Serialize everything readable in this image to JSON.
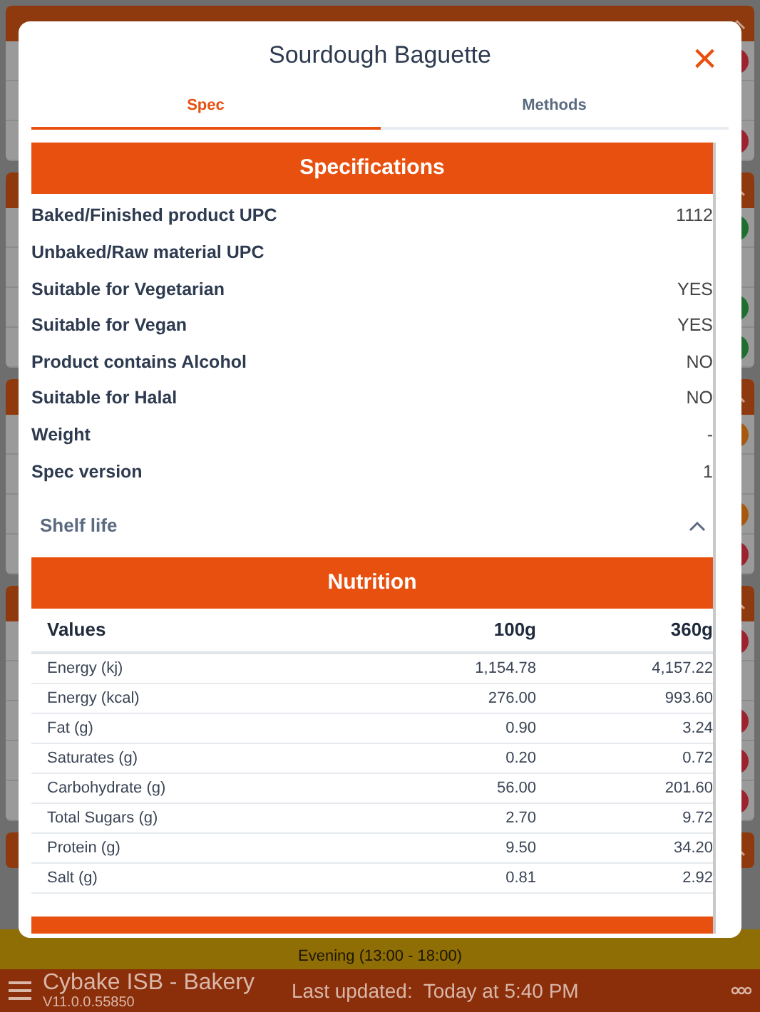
{
  "background": {
    "sections": [
      {
        "expanded": true,
        "rows": [
          {
            "kind": "status",
            "color": "#9b2330"
          },
          {
            "kind": "label"
          },
          {
            "kind": "status",
            "color": "#9b2330"
          }
        ]
      },
      {
        "expanded": true,
        "rows": [
          {
            "kind": "status",
            "color": "#1f6e30"
          },
          {
            "kind": "label"
          },
          {
            "kind": "status",
            "color": "#1f6e30"
          },
          {
            "kind": "status",
            "color": "#1f6e30"
          }
        ]
      },
      {
        "expanded": true,
        "rows": [
          {
            "kind": "status",
            "color": "#a5580f"
          },
          {
            "kind": "label"
          },
          {
            "kind": "status",
            "color": "#a5580f"
          },
          {
            "kind": "status",
            "color": "#9b2330"
          }
        ]
      },
      {
        "expanded": true,
        "rows": [
          {
            "kind": "status",
            "color": "#9b2330"
          },
          {
            "kind": "label"
          },
          {
            "kind": "status",
            "color": "#9b2330"
          },
          {
            "kind": "status",
            "color": "#9b2330"
          },
          {
            "kind": "status",
            "color": "#9b2330"
          }
        ]
      },
      {
        "expanded": true
      }
    ],
    "order_bar": {
      "slot": "Evening (13:00 - 18:00)"
    }
  },
  "modal": {
    "title": "Sourdough Baguette",
    "close": "×",
    "tabs": [
      {
        "label": "Spec",
        "selected": true
      },
      {
        "label": "Methods",
        "selected": false
      }
    ],
    "specifications": {
      "heading": "Specifications",
      "rows": [
        {
          "label": "Baked/Finished product UPC",
          "value": "1112"
        },
        {
          "label": "Unbaked/Raw material UPC"
        },
        {
          "label": "Suitable for Vegetarian",
          "value": "YES"
        },
        {
          "label": "Suitable for Vegan",
          "value": "YES"
        },
        {
          "label": "Product contains Alcohol",
          "value": "NO"
        },
        {
          "label": "Suitable for Halal",
          "value": "NO"
        },
        {
          "label": "Weight",
          "value": "-"
        },
        {
          "label": "Spec version",
          "value": "1"
        }
      ]
    },
    "shelf_life": {
      "label": "Shelf life",
      "expanded": true
    },
    "nutrition": {
      "heading": "Nutrition",
      "columns": [
        "Values",
        "100g",
        "360g"
      ],
      "rows": [
        [
          "Energy (kj)",
          "1,154.78",
          "4,157.22"
        ],
        [
          "Energy (kcal)",
          "276.00",
          "993.60"
        ],
        [
          "Fat (g)",
          "0.90",
          "3.24"
        ],
        [
          "Saturates (g)",
          "0.20",
          "0.72"
        ],
        [
          "Carbohydrate (g)",
          "56.00",
          "201.60"
        ],
        [
          "Total Sugars (g)",
          "2.70",
          "9.72"
        ],
        [
          "Protein (g)",
          "9.50",
          "34.20"
        ],
        [
          "Salt (g)",
          "0.81",
          "2.92"
        ]
      ]
    }
  },
  "footer": {
    "app": "Cybake ISB - Bakery",
    "version": "V11.0.0.55850",
    "last_updated": "Last updated:  Today at 5:40 PM"
  }
}
